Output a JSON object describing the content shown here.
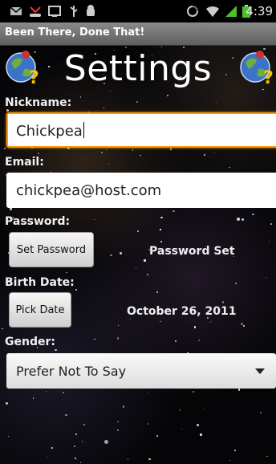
{
  "status_bar": {
    "time": "4:39",
    "icons": [
      "mail-icon",
      "missed-call-icon",
      "screen-icon",
      "usb-icon",
      "android-debug-icon",
      "sync-icon",
      "wifi-icon",
      "signal-icon",
      "battery-icon"
    ]
  },
  "app": {
    "title": "Been There, Done That!"
  },
  "header": {
    "title": "Settings",
    "logo_icon": "globe-question-icon"
  },
  "form": {
    "nickname": {
      "label": "Nickname:",
      "value": "Chickpea"
    },
    "email": {
      "label": "Email:",
      "value": "chickpea@host.com"
    },
    "password": {
      "label": "Password:",
      "button": "Set Password",
      "status": "Password Set"
    },
    "birth_date": {
      "label": "Birth Date:",
      "button": "Pick Date",
      "value": "October 26, 2011"
    },
    "gender": {
      "label": "Gender:",
      "selected": "Prefer Not To Say"
    }
  },
  "colors": {
    "focus": "#ff9a00",
    "title_bar": "#6e6e6e",
    "background": "#050508"
  }
}
